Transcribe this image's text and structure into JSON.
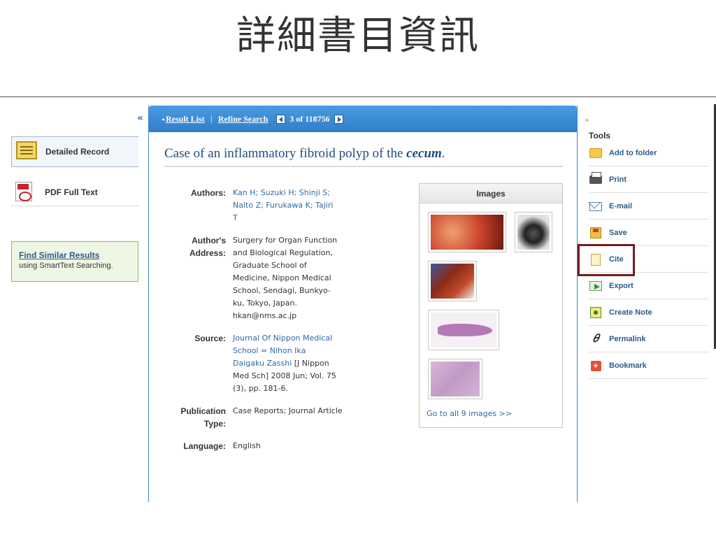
{
  "slide_title": "詳細書目資訊",
  "left": {
    "collapse": "«",
    "detailed_record": "Detailed Record",
    "pdf_full_text": "PDF Full Text",
    "similar_link": "Find Similar Results",
    "similar_sub": "using SmartText Searching."
  },
  "nav": {
    "result_list": "Result List",
    "refine_search": "Refine Search",
    "count": "3 of 118756"
  },
  "record": {
    "title_pre": "Case of an inflammatory fibroid polyp of the ",
    "title_em": "cecum",
    "title_post": ".",
    "authors_label": "Authors:",
    "authors": "Kan H; Suzuki H; Shinji S; Naito Z; Furukawa K; Tajiri T",
    "address_label": "Author's Address:",
    "address": "Surgery for Organ Function and Biological Regulation, Graduate School of Medicine, Nippon Medical School, Sendagi, Bunkyo-ku, Tokyo, Japan. hkan@nms.ac.jp",
    "source_label": "Source:",
    "source_link": "Journal Of Nippon Medical School = Nihon Ika Daigaku Zasshi",
    "source_rest": " [J Nippon Med Sch] 2008 Jun; Vol. 75 (3), pp. 181-6.",
    "pubtype_label": "Publication Type:",
    "pubtype": "Case Reports; Journal Article",
    "language_label": "Language:",
    "language": "English"
  },
  "images": {
    "header": "Images",
    "go_all": "Go to all 9 images >>"
  },
  "tools": {
    "collapse": "»",
    "title": "Tools",
    "items": [
      {
        "label": "Add to folder",
        "icon": "folder-icon"
      },
      {
        "label": "Print",
        "icon": "printer-icon"
      },
      {
        "label": "E-mail",
        "icon": "email-icon"
      },
      {
        "label": "Save",
        "icon": "save-icon"
      },
      {
        "label": "Cite",
        "icon": "cite-icon"
      },
      {
        "label": "Export",
        "icon": "export-icon"
      },
      {
        "label": "Create Note",
        "icon": "note-icon"
      },
      {
        "label": "Permalink",
        "icon": "link-icon"
      },
      {
        "label": "Bookmark",
        "icon": "bookmark-icon"
      }
    ]
  },
  "colors": {
    "nav_blue": "#2f7ec8",
    "link_blue": "#2f6aa8",
    "highlight": "#7a1a1a"
  }
}
